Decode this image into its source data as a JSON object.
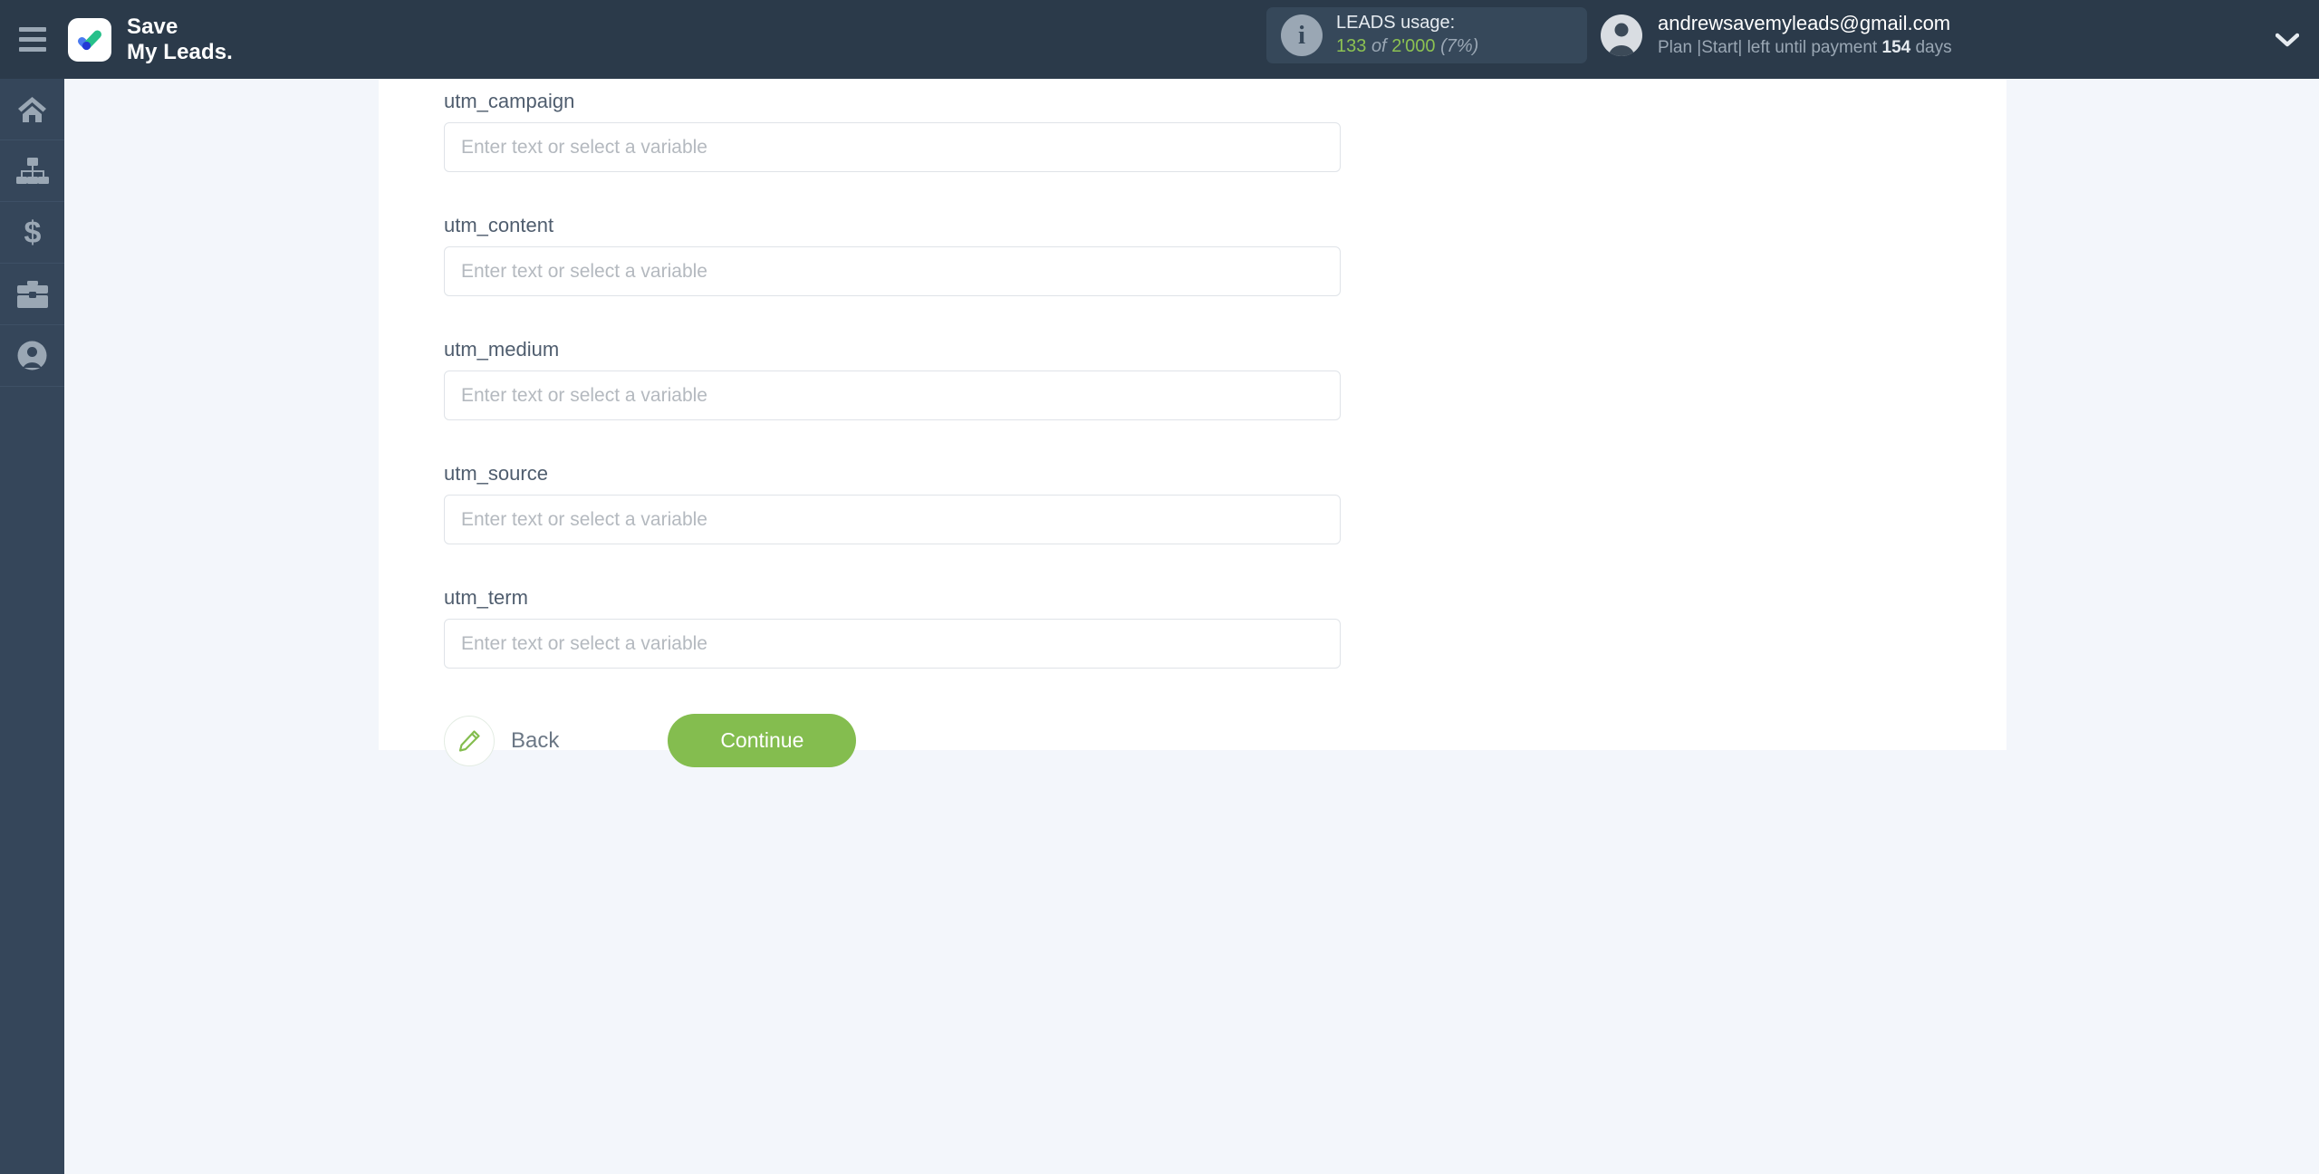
{
  "header": {
    "menu_icon": "hamburger-icon",
    "brand_line1": "Save",
    "brand_line2": "My Leads.",
    "logo_icon": "checkmark-logo-icon",
    "leads_usage": {
      "info_icon": "info-icon",
      "title": "LEADS usage:",
      "used": "133",
      "of": "of",
      "total": "2'000",
      "percent": "(7%)"
    },
    "account": {
      "avatar_icon": "user-avatar-icon",
      "email": "andrewsavemyleads@gmail.com",
      "plan_prefix": "Plan |Start| left until payment",
      "plan_days_value": "154",
      "plan_days_unit": "days"
    },
    "chevron_icon": "chevron-down-icon"
  },
  "sidebar": {
    "items": [
      {
        "icon": "home-icon",
        "label": "Home"
      },
      {
        "icon": "connections-icon",
        "label": "Connections"
      },
      {
        "icon": "dollar-icon",
        "label": "Billing"
      },
      {
        "icon": "briefcase-icon",
        "label": "Services"
      },
      {
        "icon": "user-icon",
        "label": "Account"
      }
    ]
  },
  "main": {
    "fields": [
      {
        "label": "utm_campaign",
        "value": "",
        "placeholder": "Enter text or select a variable"
      },
      {
        "label": "utm_content",
        "value": "",
        "placeholder": "Enter text or select a variable"
      },
      {
        "label": "utm_medium",
        "value": "",
        "placeholder": "Enter text or select a variable"
      },
      {
        "label": "utm_source",
        "value": "",
        "placeholder": "Enter text or select a variable"
      },
      {
        "label": "utm_term",
        "value": "",
        "placeholder": "Enter text or select a variable"
      }
    ],
    "actions": {
      "back_label": "Back",
      "back_icon": "pencil-icon",
      "continue_label": "Continue"
    }
  },
  "colors": {
    "header_bg": "#2b3a4a",
    "sidebar_bg": "#35465a",
    "page_bg": "#f3f6fb",
    "panel_bg": "#ffffff",
    "accent_green": "#84bd4f",
    "usage_green": "#8cc152",
    "label_gray": "#4f5d6e",
    "placeholder_gray": "#b4b9bf"
  }
}
